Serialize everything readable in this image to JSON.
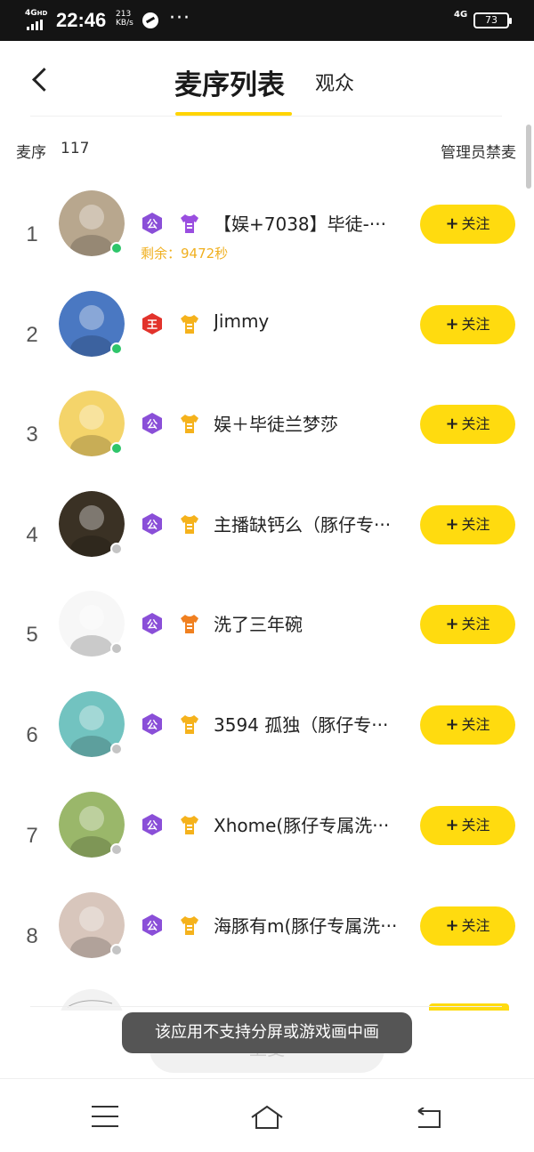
{
  "status_bar": {
    "network": "4G",
    "network_super": "HD",
    "time": "22:46",
    "speed_value": "213",
    "speed_unit": "KB/s",
    "more": "···",
    "right_network": "4G",
    "battery": "73"
  },
  "header": {
    "tab_active": "麦序列表",
    "tab_inactive": "观众"
  },
  "queue": {
    "label": "麦序",
    "count": "117",
    "admin_ban": "管理员禁麦"
  },
  "follow_label": "关注",
  "follow_plus": "+",
  "rows": [
    {
      "rank": "1",
      "name": "【娱+7038】毕徒-···",
      "remain": "剩余：9472秒",
      "status": "online",
      "badge1": "公",
      "badge1_color": "#8a4fd8",
      "badge2_color": "#9a4ee0",
      "avatar_color": "#b8a78e"
    },
    {
      "rank": "2",
      "name": "Jimmy",
      "status": "online",
      "badge1": "王",
      "badge1_color": "#e2332c",
      "badge2_color": "#f5b21c",
      "avatar_color": "#4a78c2"
    },
    {
      "rank": "3",
      "name": "娱＋毕徒兰梦莎",
      "status": "online",
      "badge1": "公",
      "badge1_color": "#8a4fd8",
      "badge2_color": "#f5b21c",
      "avatar_color": "#f4d46a"
    },
    {
      "rank": "4",
      "name": "主播缺钙么（豚仔专···",
      "status": "offline",
      "badge1": "公",
      "badge1_color": "#8a4fd8",
      "badge2_color": "#f5b21c",
      "avatar_color": "#3a3124"
    },
    {
      "rank": "5",
      "name": "洗了三年碗",
      "status": "offline",
      "badge1": "公",
      "badge1_color": "#8a4fd8",
      "badge2_color": "#f08020",
      "avatar_color": "#f7f7f7"
    },
    {
      "rank": "6",
      "name": "3594 孤独（豚仔专···",
      "status": "offline",
      "badge1": "公",
      "badge1_color": "#8a4fd8",
      "badge2_color": "#f5b21c",
      "avatar_color": "#72c3c0"
    },
    {
      "rank": "7",
      "name": "Xhome(豚仔专属洗···",
      "status": "offline",
      "badge1": "公",
      "badge1_color": "#8a4fd8",
      "badge2_color": "#f5b21c",
      "avatar_color": "#9ab76a"
    },
    {
      "rank": "8",
      "name": "海豚有m(豚仔专属洗···",
      "status": "offline",
      "badge1": "公",
      "badge1_color": "#8a4fd8",
      "badge2_color": "#f5b21c",
      "avatar_color": "#d8c6bc"
    }
  ],
  "colors": {
    "accent": "#ffdb0f",
    "online": "#2ec56a",
    "offline": "#c4c4c4",
    "remain": "#f0b020"
  },
  "bottom_button": "上麦",
  "toast": "该应用不支持分屏或游戏画中画",
  "nav_icons": [
    "menu-icon",
    "home-icon",
    "back-icon"
  ]
}
